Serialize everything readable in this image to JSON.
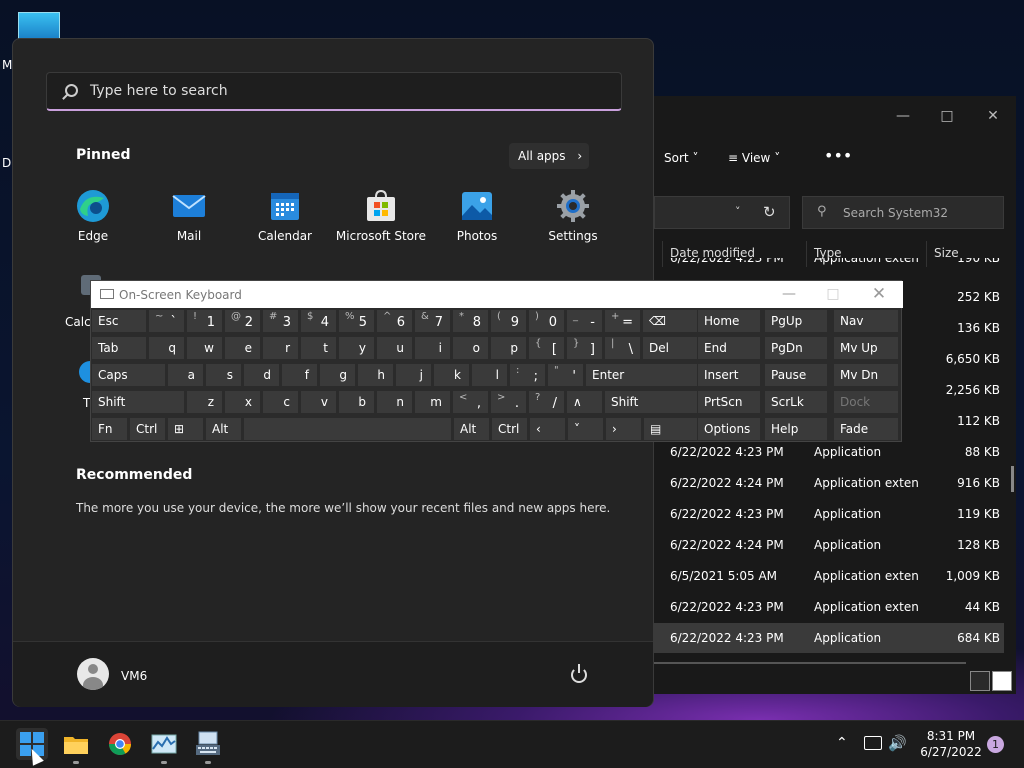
{
  "desktop": {
    "label_m": "M",
    "label_d": "Da"
  },
  "explorer": {
    "sort_label": "Sort",
    "view_label": "View",
    "search_placeholder": "Search System32",
    "columns": {
      "date": "Date modified",
      "type": "Type",
      "size": "Size"
    },
    "rows": [
      {
        "date": "6/22/2022 4:23 PM",
        "type": "Application exten...",
        "size": "190 KB"
      },
      {
        "date": "",
        "type": "",
        "size": "252 KB"
      },
      {
        "date": "",
        "type": "",
        "size": "136 KB"
      },
      {
        "date": "",
        "type": "",
        "size": "6,650 KB"
      },
      {
        "date": "",
        "type": "",
        "size": "2,256 KB"
      },
      {
        "date": "",
        "type": "",
        "size": "112 KB"
      },
      {
        "date": "6/22/2022 4:23 PM",
        "type": "Application",
        "size": "88 KB"
      },
      {
        "date": "6/22/2022 4:24 PM",
        "type": "Application exten...",
        "size": "916 KB"
      },
      {
        "date": "6/22/2022 4:23 PM",
        "type": "Application",
        "size": "119 KB"
      },
      {
        "date": "6/22/2022 4:24 PM",
        "type": "Application",
        "size": "128 KB"
      },
      {
        "date": "6/5/2021 5:05 AM",
        "type": "Application exten...",
        "size": "1,009 KB"
      },
      {
        "date": "6/22/2022 4:23 PM",
        "type": "Application exten...",
        "size": "44 KB"
      },
      {
        "date": "6/22/2022 4:23 PM",
        "type": "Application",
        "size": "684 KB"
      }
    ]
  },
  "start": {
    "search_placeholder": "Type here to search",
    "pinned_title": "Pinned",
    "all_apps": "All apps",
    "pinned": [
      {
        "label": "Edge",
        "icon": "edge-icon"
      },
      {
        "label": "Mail",
        "icon": "mail-icon"
      },
      {
        "label": "Calendar",
        "icon": "calendar-icon"
      },
      {
        "label": "Microsoft Store",
        "icon": "store-icon"
      },
      {
        "label": "Photos",
        "icon": "photos-icon"
      },
      {
        "label": "Settings",
        "icon": "settings-icon"
      }
    ],
    "row2": [
      {
        "label": "Calc"
      },
      {
        "label": "T"
      }
    ],
    "recommended_title": "Recommended",
    "recommended_text": "The more you use your device, the more we’ll show your recent files and new apps here.",
    "user_name": "VM6"
  },
  "osk": {
    "title": "On-Screen Keyboard",
    "keys": {
      "esc": "Esc",
      "tab": "Tab",
      "caps": "Caps",
      "shift": "Shift",
      "fn": "Fn",
      "ctrl": "Ctrl",
      "alt": "Alt",
      "del": "Del",
      "enter": "Enter",
      "home": "Home",
      "pgup": "PgUp",
      "nav": "Nav",
      "end": "End",
      "pgdn": "PgDn",
      "mvup": "Mv Up",
      "insert": "Insert",
      "pause": "Pause",
      "mvdn": "Mv Dn",
      "prtscn": "PrtScn",
      "scrlk": "ScrLk",
      "dock": "Dock",
      "options": "Options",
      "help": "Help",
      "fade": "Fade"
    }
  },
  "taskbar": {
    "time": "8:31 PM",
    "date": "6/27/2022",
    "notifications": "1"
  }
}
